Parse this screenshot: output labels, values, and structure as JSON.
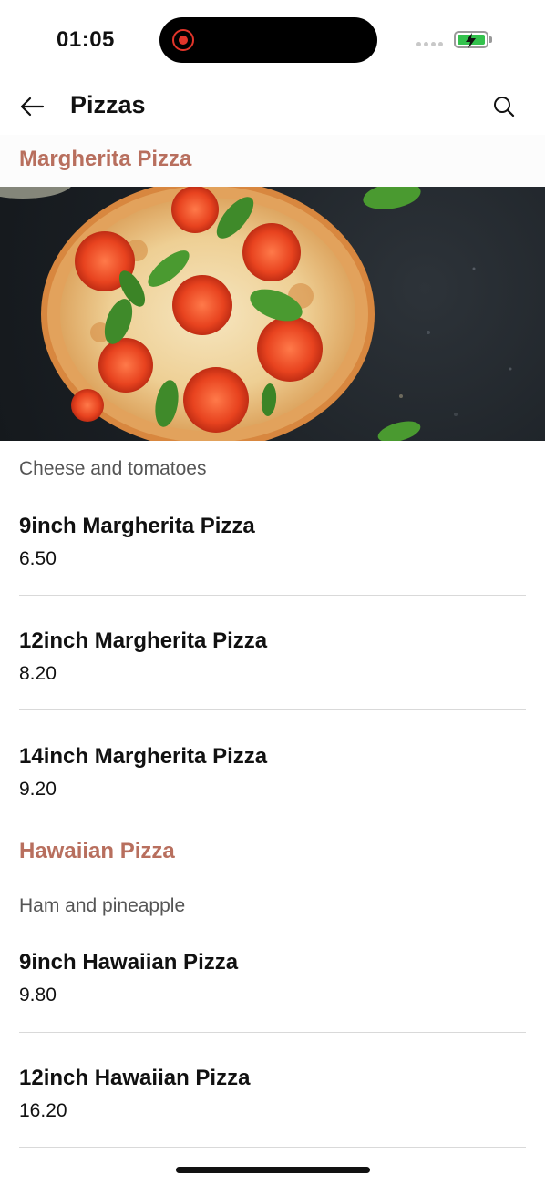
{
  "status_bar": {
    "time": "01:05"
  },
  "header": {
    "title": "Pizzas",
    "back_icon": "arrow-left-icon",
    "search_icon": "search-icon"
  },
  "theme": {
    "accent": "#b86f5e",
    "battery": "#33c24d",
    "recording": "#e2352a"
  },
  "sections": [
    {
      "title": "Margherita Pizza",
      "description": "Cheese and tomatoes",
      "items": [
        {
          "name": "9inch Margherita Pizza",
          "price": "6.50"
        },
        {
          "name": "12inch Margherita Pizza",
          "price": "8.20"
        },
        {
          "name": "14inch Margherita Pizza",
          "price": "9.20"
        }
      ]
    },
    {
      "title": "Hawaiian Pizza",
      "description": "Ham and pineapple",
      "items": [
        {
          "name": "9inch Hawaiian Pizza",
          "price": "9.80"
        },
        {
          "name": "12inch Hawaiian Pizza",
          "price": "16.20"
        }
      ]
    }
  ]
}
